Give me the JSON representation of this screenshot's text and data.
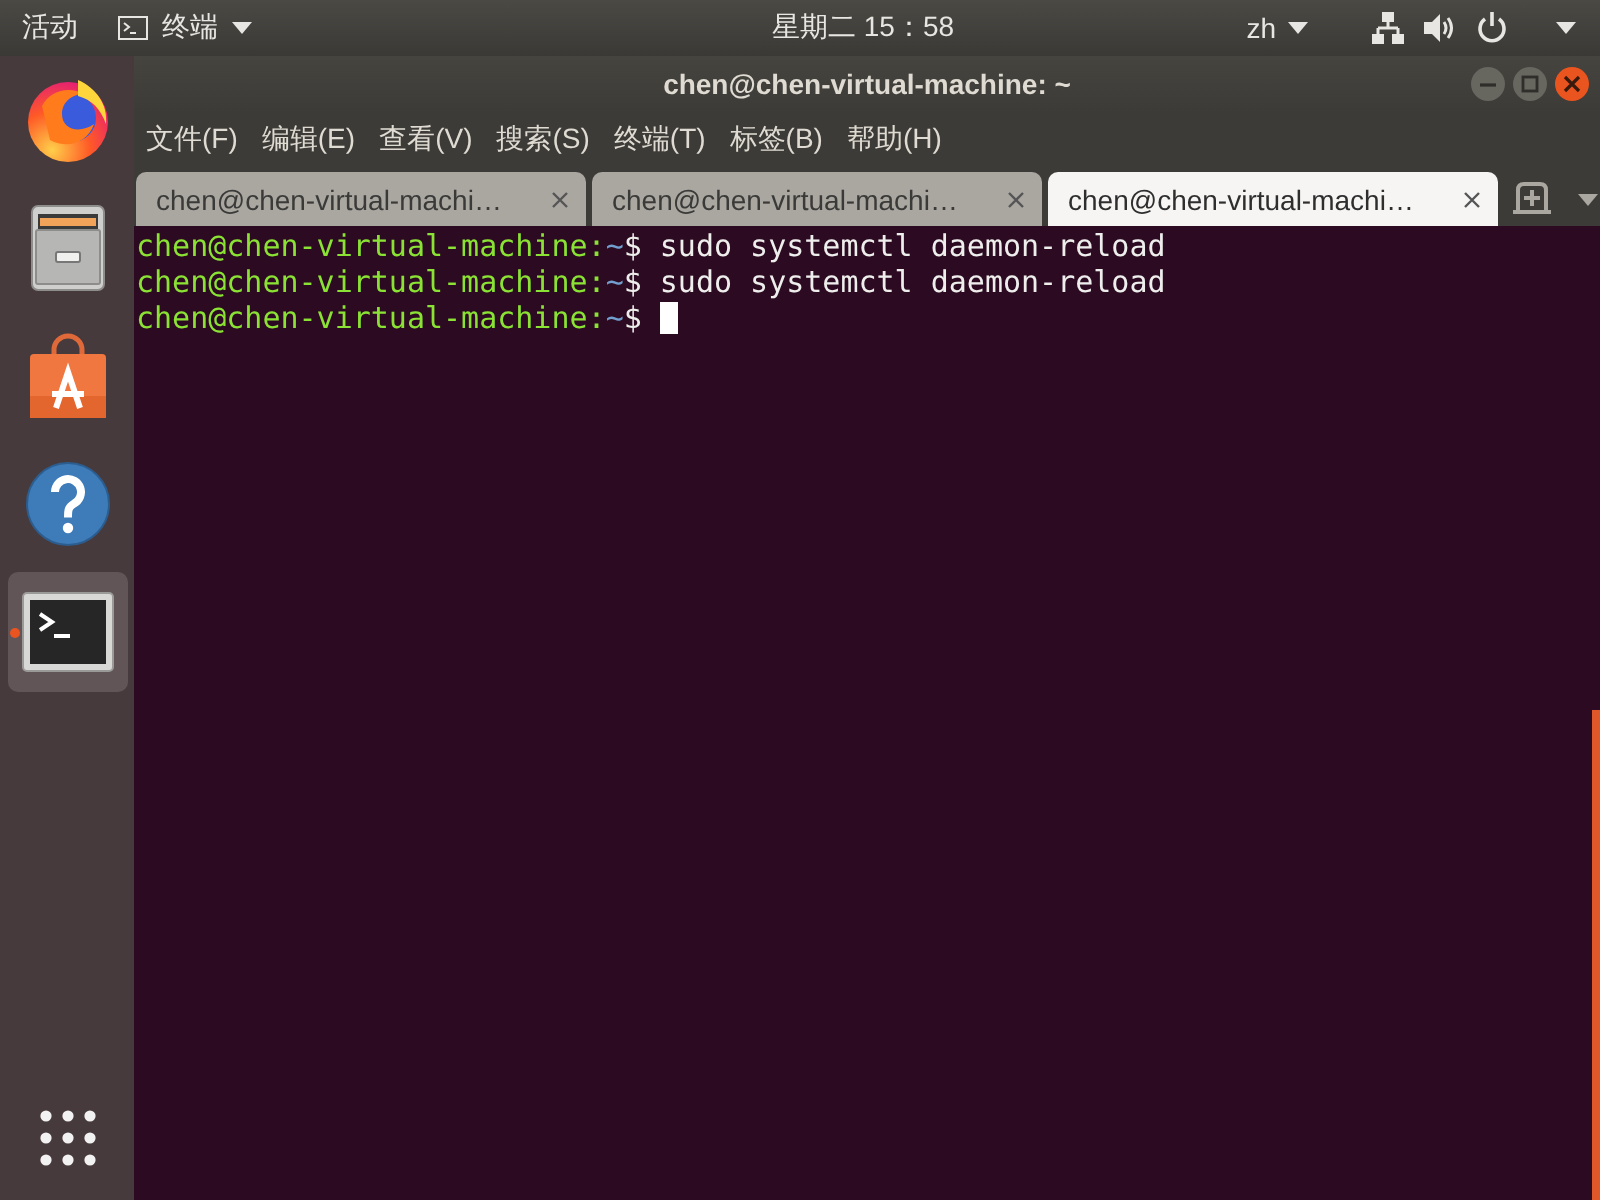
{
  "top_bar": {
    "activities": "活动",
    "app_menu": "终端",
    "clock": "星期二 15：58",
    "input_method": "zh"
  },
  "dock": {
    "items": [
      {
        "kind": "browser",
        "running": false,
        "selected": false
      },
      {
        "kind": "files",
        "running": false,
        "selected": false
      },
      {
        "kind": "store",
        "running": false,
        "selected": false
      },
      {
        "kind": "help",
        "running": false,
        "selected": false
      },
      {
        "kind": "terminal",
        "running": true,
        "selected": true
      }
    ]
  },
  "window": {
    "title": "chen@chen-virtual-machine: ~",
    "menu": [
      "文件(F)",
      "编辑(E)",
      "查看(V)",
      "搜索(S)",
      "终端(T)",
      "标签(B)",
      "帮助(H)"
    ],
    "tabs": [
      {
        "label": "chen@chen-virtual-machi…",
        "selected": false
      },
      {
        "label": "chen@chen-virtual-machi…",
        "selected": false
      },
      {
        "label": "chen@chen-virtual-machi…",
        "selected": true
      }
    ]
  },
  "terminal": {
    "lines": [
      {
        "user_host": "chen@chen-virtual-machine:",
        "path": "~",
        "symbol": "$",
        "command": "sudo systemctl daemon-reload",
        "cursor": false
      },
      {
        "user_host": "chen@chen-virtual-machine:",
        "path": "~",
        "symbol": "$",
        "command": "sudo systemctl daemon-reload",
        "cursor": false
      },
      {
        "user_host": "chen@chen-virtual-machine:",
        "path": "~",
        "symbol": "$",
        "cursor": true
      }
    ]
  }
}
